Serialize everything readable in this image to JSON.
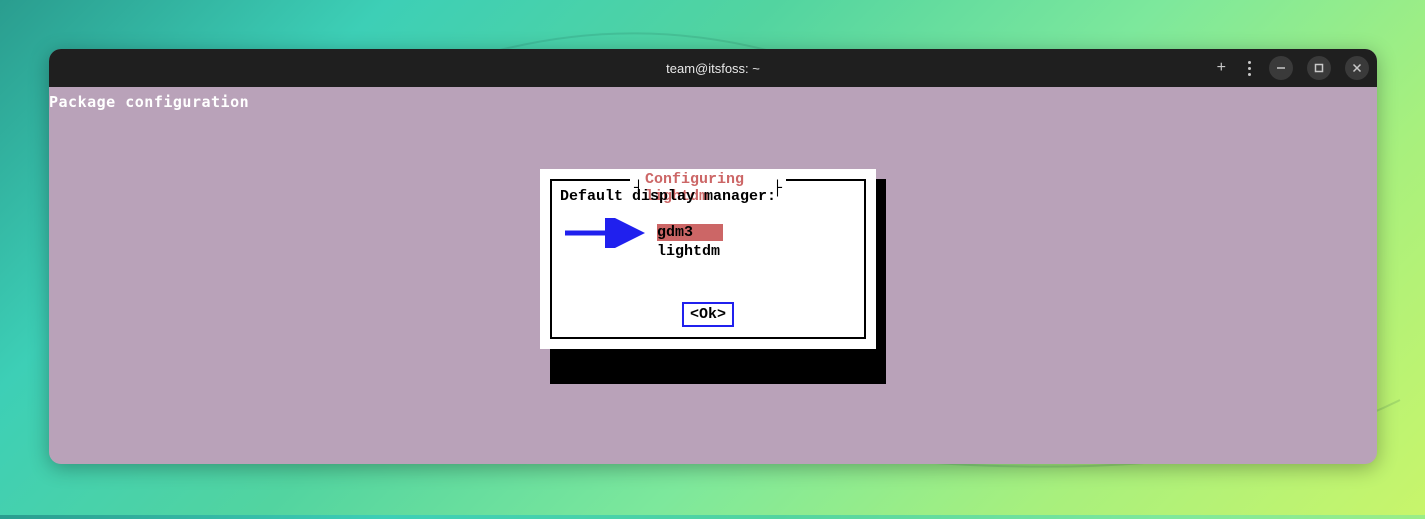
{
  "window": {
    "title": "team@itsfoss: ~"
  },
  "terminal": {
    "header_text": "Package configuration"
  },
  "dialog": {
    "title": " Configuring lightdm ",
    "prompt": "Default display manager:",
    "options": [
      {
        "label": "gdm3",
        "selected": true
      },
      {
        "label": "lightdm",
        "selected": false
      }
    ],
    "ok_button": "<Ok>"
  },
  "colors": {
    "terminal_bg": "#b9a2b9",
    "dialog_title": "#cc6666",
    "selected_bg": "#cc6666",
    "ok_border": "#2020ee",
    "arrow": "#2020ee"
  }
}
